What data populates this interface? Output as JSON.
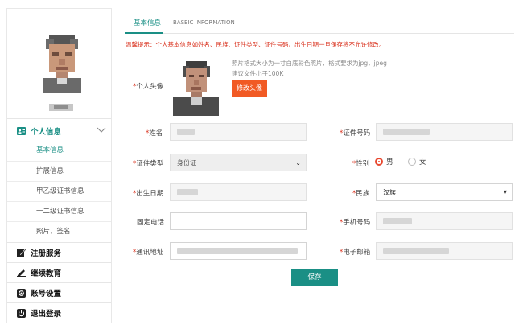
{
  "sidebar": {
    "menu": [
      {
        "label": "个人信息",
        "icon": "id-card-icon",
        "active": true
      },
      {
        "label": "注册服务",
        "icon": "edit-icon"
      },
      {
        "label": "继续教育",
        "icon": "pencil-icon"
      },
      {
        "label": "账号设置",
        "icon": "settings-icon"
      },
      {
        "label": "退出登录",
        "icon": "power-icon"
      }
    ],
    "sub_items": [
      "基本信息",
      "扩展信息",
      "甲乙级证书信息",
      "一二级证书信息",
      "照片、签名"
    ]
  },
  "tabs": {
    "active": "基本信息",
    "english": "BASEIC INFORMATION"
  },
  "notice": "温馨提示：个人基本信息如姓名、民族、证件类型、证件号码、出生日期一旦保存将不允许修改。",
  "photo": {
    "label": "个人头像",
    "tip_line1": "照片格式大小为一寸白底彩色照片，格式要求为jpg，jpeg",
    "tip_line2": "建议文件小于100K",
    "upload_button": "修改头像"
  },
  "form": {
    "name_label": "姓名",
    "id_number_label": "证件号码",
    "id_type_label": "证件类型",
    "id_type_value": "身份证",
    "gender_label": "性别",
    "gender_male": "男",
    "gender_female": "女",
    "gender_selected": "男",
    "birth_label": "出生日期",
    "ethnicity_label": "民族",
    "ethnicity_value": "汉族",
    "phone_label": "固定电话",
    "mobile_label": "手机号码",
    "address_label": "通讯地址",
    "email_label": "电子邮箱",
    "required_mark": "*"
  },
  "save_button": "保存",
  "colors": {
    "accent": "#1a8f85",
    "warning": "#d9301c",
    "upload": "#f15a24"
  }
}
